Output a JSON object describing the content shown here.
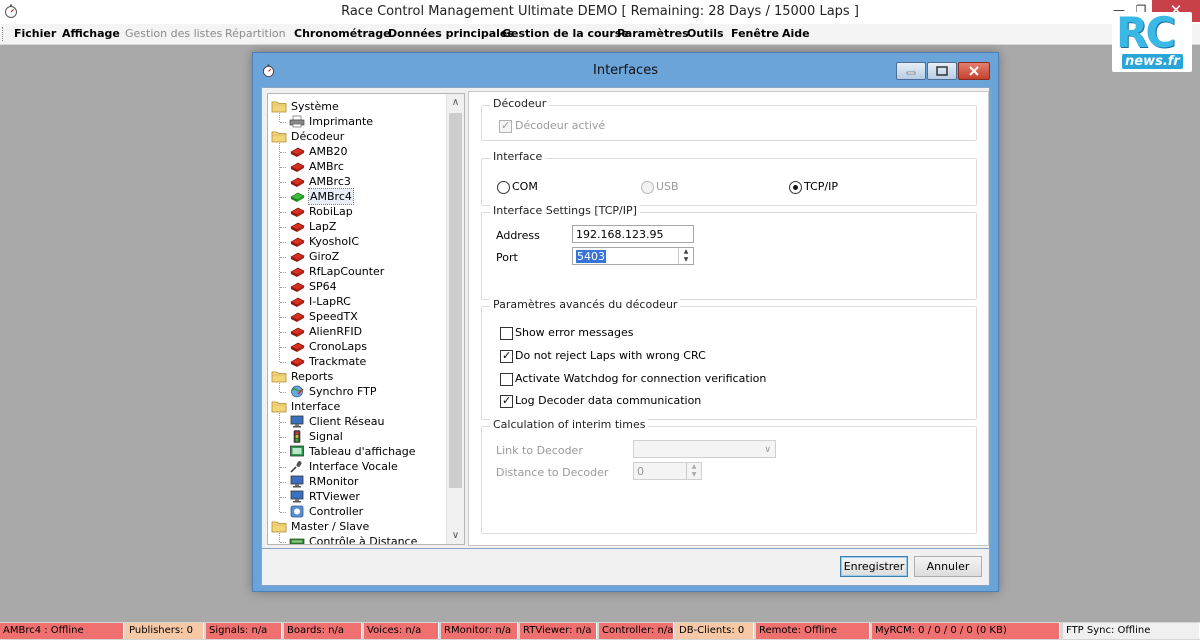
{
  "window": {
    "title": "Race Control Management Ultimate DEMO  [ Remaining: 28 Days / 15000 Laps ]"
  },
  "menu": {
    "items": [
      {
        "label": "Fichier",
        "enabled": true
      },
      {
        "label": "Affichage",
        "enabled": true
      },
      {
        "label": "Gestion des listes",
        "enabled": false
      },
      {
        "label": "Répartition",
        "enabled": false
      },
      {
        "label": "Chronométrage",
        "enabled": true
      },
      {
        "label": "Données principales",
        "enabled": true
      },
      {
        "label": "Gestion de la course",
        "enabled": true
      },
      {
        "label": "Paramètres",
        "enabled": true
      },
      {
        "label": "Outils",
        "enabled": true
      },
      {
        "label": "Fenêtre",
        "enabled": true
      },
      {
        "label": "Aide",
        "enabled": true
      }
    ]
  },
  "logo": {
    "main": "RC",
    "sub": "news.fr"
  },
  "dialog": {
    "title": "Interfaces",
    "tree": [
      {
        "label": "Système",
        "level": 0,
        "icon": "folder-icon"
      },
      {
        "label": "Imprimante",
        "level": 1,
        "icon": "printer-icon"
      },
      {
        "label": "Décodeur",
        "level": 0,
        "icon": "folder-icon"
      },
      {
        "label": "AMB20",
        "level": 1,
        "icon": "chip-red-icon"
      },
      {
        "label": "AMBrc",
        "level": 1,
        "icon": "chip-red-icon"
      },
      {
        "label": "AMBrc3",
        "level": 1,
        "icon": "chip-red-icon"
      },
      {
        "label": "AMBrc4",
        "level": 1,
        "icon": "chip-green-icon",
        "selected": true
      },
      {
        "label": "RobiLap",
        "level": 1,
        "icon": "chip-red-icon"
      },
      {
        "label": "LapZ",
        "level": 1,
        "icon": "chip-red-icon"
      },
      {
        "label": "KyoshoIC",
        "level": 1,
        "icon": "chip-red-icon"
      },
      {
        "label": "GiroZ",
        "level": 1,
        "icon": "chip-red-icon"
      },
      {
        "label": "RfLapCounter",
        "level": 1,
        "icon": "chip-red-icon"
      },
      {
        "label": "SP64",
        "level": 1,
        "icon": "chip-red-icon"
      },
      {
        "label": "I-LapRC",
        "level": 1,
        "icon": "chip-red-icon"
      },
      {
        "label": "SpeedTX",
        "level": 1,
        "icon": "chip-red-icon"
      },
      {
        "label": "AlienRFID",
        "level": 1,
        "icon": "chip-red-icon"
      },
      {
        "label": "CronoLaps",
        "level": 1,
        "icon": "chip-red-icon"
      },
      {
        "label": "Trackmate",
        "level": 1,
        "icon": "chip-red-icon"
      },
      {
        "label": "Reports",
        "level": 0,
        "icon": "folder-icon"
      },
      {
        "label": "Synchro FTP",
        "level": 1,
        "icon": "globe-icon"
      },
      {
        "label": "Interface",
        "level": 0,
        "icon": "folder-icon"
      },
      {
        "label": "Client Réseau",
        "level": 1,
        "icon": "monitor-icon"
      },
      {
        "label": "Signal",
        "level": 1,
        "icon": "signal-icon"
      },
      {
        "label": "Tableau d'affichage",
        "level": 1,
        "icon": "board-icon"
      },
      {
        "label": "Interface Vocale",
        "level": 1,
        "icon": "microphone-icon"
      },
      {
        "label": "RMonitor",
        "level": 1,
        "icon": "monitor-icon"
      },
      {
        "label": "RTViewer",
        "level": 1,
        "icon": "monitor-icon"
      },
      {
        "label": "Controller",
        "level": 1,
        "icon": "controller-icon"
      },
      {
        "label": "Master / Slave",
        "level": 0,
        "icon": "folder-icon"
      },
      {
        "label": "Contrôle à Distance",
        "level": 1,
        "icon": "remote-icon"
      }
    ],
    "decoder_group": {
      "title": "Décodeur",
      "enabled_label": "Décodeur activé",
      "enabled_checked": true
    },
    "interface_group": {
      "title": "Interface",
      "options": [
        {
          "label": "COM",
          "selected": false,
          "disabled": false
        },
        {
          "label": "USB",
          "selected": false,
          "disabled": true
        },
        {
          "label": "TCP/IP",
          "selected": true,
          "disabled": false
        }
      ]
    },
    "settings_group": {
      "title": "Interface Settings [TCP/IP]",
      "address_label": "Address",
      "address_value": "192.168.123.95",
      "port_label": "Port",
      "port_value": "5403"
    },
    "advanced_group": {
      "title": "Paramètres avancés du décodeur",
      "options": [
        {
          "label": "Show error messages",
          "checked": false
        },
        {
          "label": "Do not reject Laps with wrong CRC",
          "checked": true
        },
        {
          "label": "Activate Watchdog for connection verification",
          "checked": false
        },
        {
          "label": "Log Decoder data communication",
          "checked": true
        }
      ]
    },
    "interim_group": {
      "title": "Calculation of interim times",
      "link_label": "Link to Decoder",
      "link_value": "",
      "distance_label": "Distance to Decoder",
      "distance_value": "0"
    },
    "buttons": {
      "save": "Enregistrer",
      "cancel": "Annuler"
    }
  },
  "statusbar": [
    {
      "label": "AMBrc4 : Offline",
      "color": "#f07070"
    },
    {
      "label": "Publishers: 0",
      "color": "#f6c8a6"
    },
    {
      "label": "Signals: n/a",
      "color": "#f07070"
    },
    {
      "label": "Boards: n/a",
      "color": "#f07070"
    },
    {
      "label": "Voices: n/a",
      "color": "#f07070"
    },
    {
      "label": "RMonitor: n/a",
      "color": "#f07070"
    },
    {
      "label": "RTViewer: n/a",
      "color": "#f07070"
    },
    {
      "label": "Controller: n/a",
      "color": "#f07070"
    },
    {
      "label": "DB-Clients: 0",
      "color": "#f6c8a6"
    },
    {
      "label": "Remote: Offline",
      "color": "#f07070"
    },
    {
      "label": "MyRCM: 0 / 0 / 0 / 0 (0 KB)",
      "color": "#f07070"
    },
    {
      "label": "FTP Sync: Offline",
      "color": "#f0f0f0"
    }
  ]
}
